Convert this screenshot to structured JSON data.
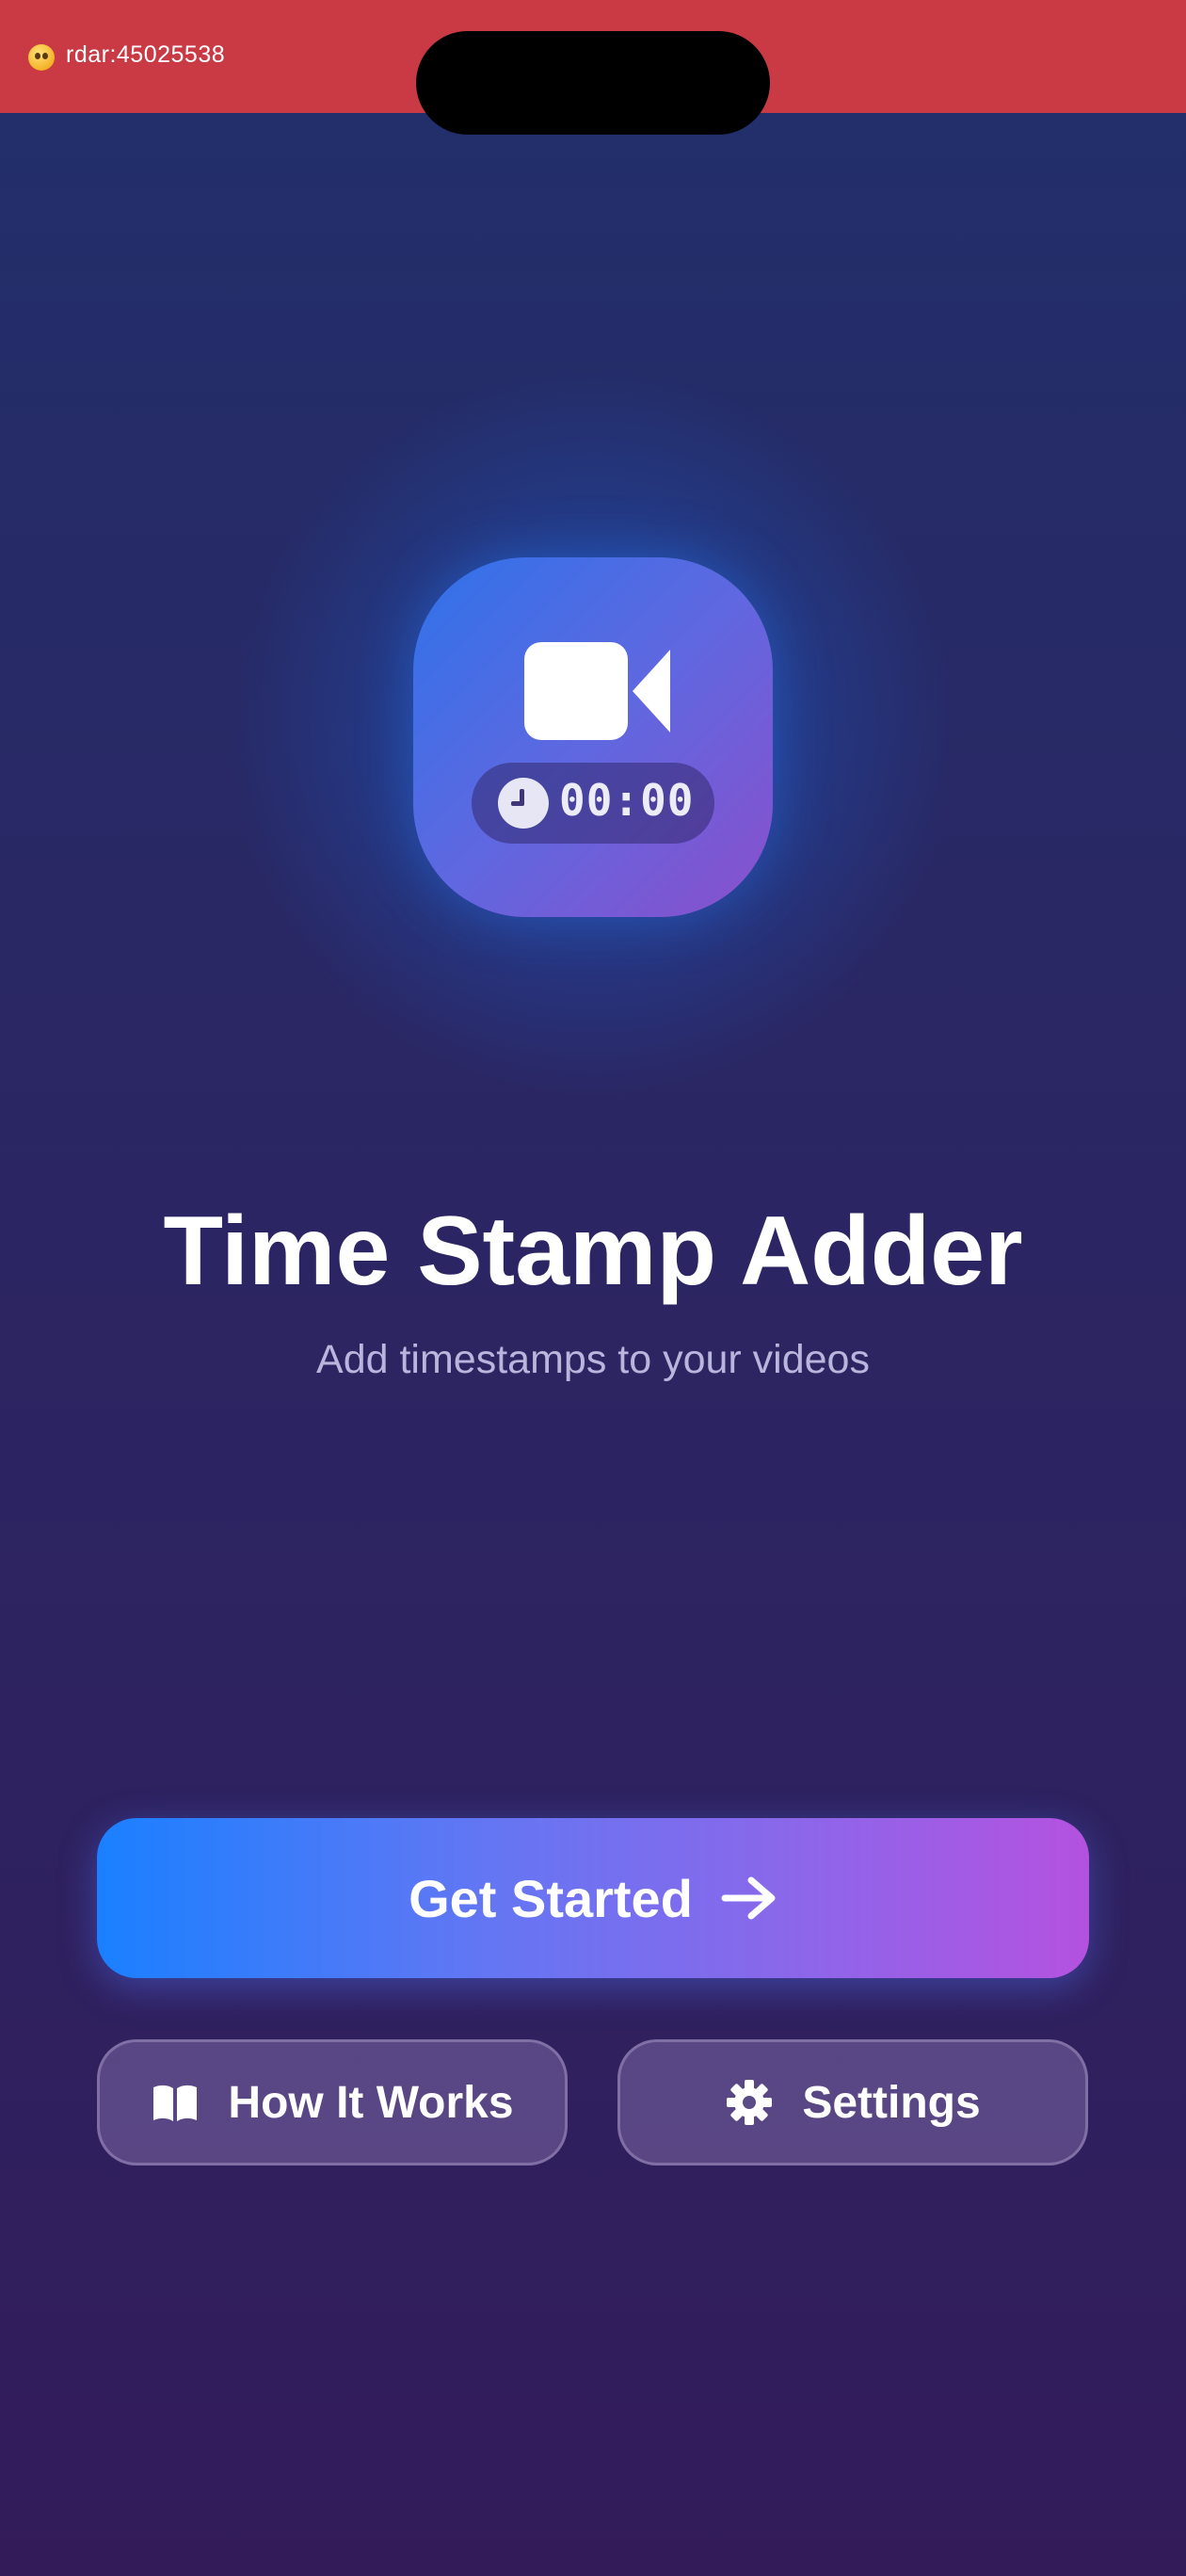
{
  "status_bar": {
    "emoji_icon": "flushed-face-emoji",
    "text": "rdar:45025538",
    "color": "#c93a44"
  },
  "app_icon": {
    "icon": "video-camera-icon",
    "clock_icon": "clock-icon",
    "time_display": "00:00"
  },
  "hero": {
    "title": "Time Stamp Adder",
    "subtitle": "Add timestamps to your videos"
  },
  "actions": {
    "primary": {
      "label": "Get Started",
      "icon": "arrow-right-icon"
    },
    "how_it_works": {
      "label": "How It Works",
      "icon": "book-open-icon"
    },
    "settings": {
      "label": "Settings",
      "icon": "gear-icon"
    }
  },
  "colors": {
    "primary_gradient_start": "#1a80ff",
    "primary_gradient_end": "#b452e0",
    "background_top": "#21306b",
    "background_bottom": "#331b5a"
  }
}
